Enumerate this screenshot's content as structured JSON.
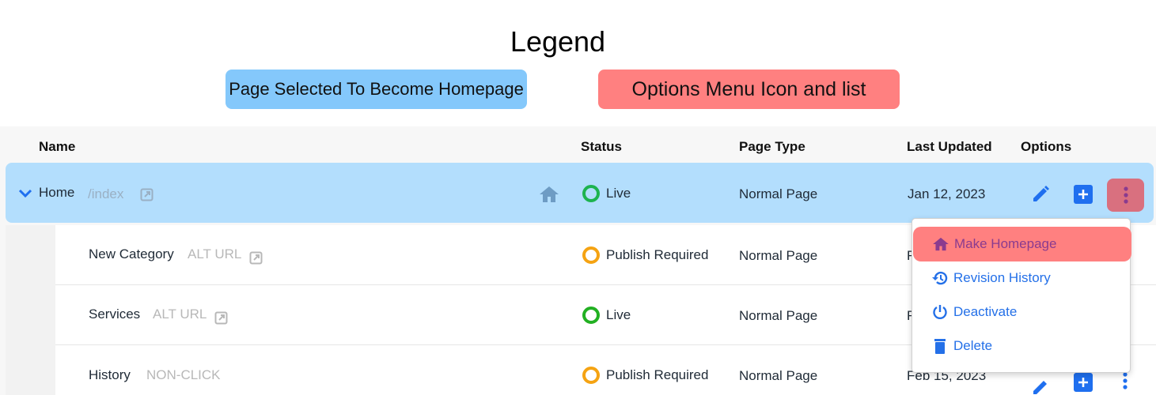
{
  "legend": {
    "title": "Legend",
    "items": [
      {
        "label": "Page Selected To Become Homepage",
        "color": "#84c8fb"
      },
      {
        "label": "Options Menu Icon and list",
        "color": "#ff8080"
      }
    ]
  },
  "table": {
    "columns": [
      "Name",
      "Status",
      "Page Type",
      "Last Updated",
      "Options"
    ],
    "rows": [
      {
        "name": "Home",
        "url": "/index",
        "status": "Live",
        "status_color": "#1db34f",
        "page_type": "Normal Page",
        "last_updated": "Jan 12, 2023",
        "selected": true,
        "expanded": true,
        "is_homepage": true
      },
      {
        "name": "New Category",
        "url": "ALT URL",
        "status": "Publish Required",
        "status_color": "#f5a312",
        "page_type": "Normal Page",
        "last_updated": "F"
      },
      {
        "name": "Services",
        "url": "ALT URL",
        "status": "Live",
        "status_color": "#22b022",
        "page_type": "Normal Page",
        "last_updated": "F"
      },
      {
        "name": "History",
        "url": "NON-CLICK",
        "status": "Publish Required",
        "status_color": "#f5a312",
        "page_type": "Normal Page",
        "last_updated": "Feb 15, 2023"
      }
    ]
  },
  "options_menu": {
    "items": [
      {
        "label": "Make Homepage",
        "icon": "home-icon",
        "highlighted": true
      },
      {
        "label": "Revision History",
        "icon": "history-icon"
      },
      {
        "label": "Deactivate",
        "icon": "power-icon"
      },
      {
        "label": "Delete",
        "icon": "trash-icon"
      }
    ]
  },
  "colors": {
    "accent": "#1f6fef",
    "selected_row": "#b3defd",
    "options_highlight": "#d9707f"
  }
}
